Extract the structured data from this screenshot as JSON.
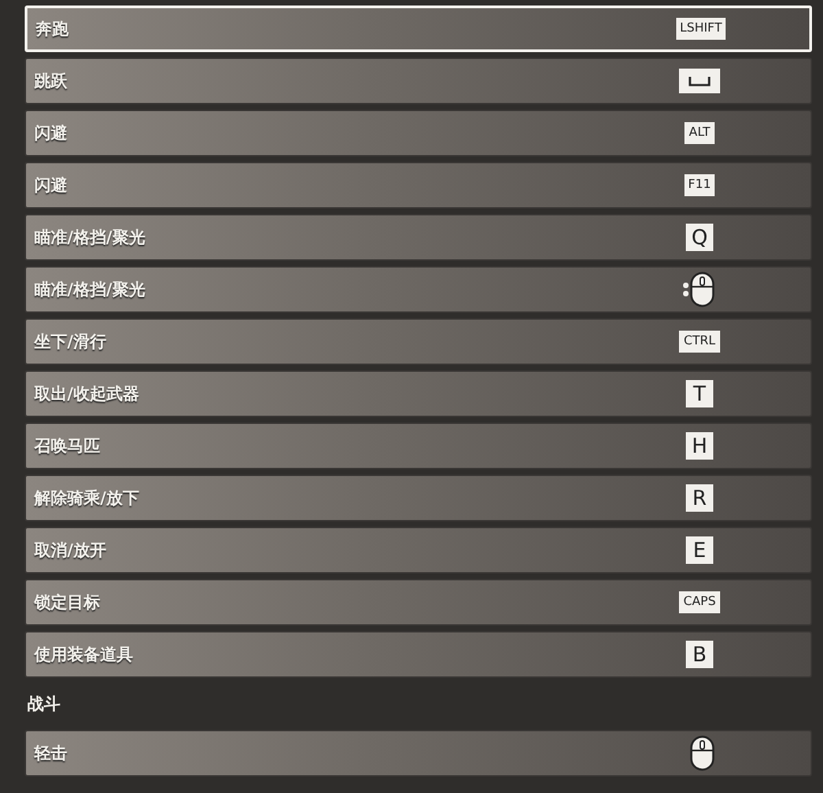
{
  "bindings": [
    {
      "action": "奔跑",
      "kind": "key",
      "key": "LSHIFT",
      "selected": true
    },
    {
      "action": "跳跃",
      "kind": "space",
      "selected": false
    },
    {
      "action": "闪避",
      "kind": "key",
      "key": "ALT",
      "selected": false
    },
    {
      "action": "闪避",
      "kind": "key",
      "key": "F11",
      "selected": false
    },
    {
      "action": "瞄准/格挡/聚光",
      "kind": "key",
      "key": "Q",
      "selected": false
    },
    {
      "action": "瞄准/格挡/聚光",
      "kind": "mouse-side",
      "selected": false
    },
    {
      "action": "坐下/滑行",
      "kind": "key",
      "key": "CTRL",
      "selected": false
    },
    {
      "action": "取出/收起武器",
      "kind": "key",
      "key": "T",
      "selected": false
    },
    {
      "action": "召唤马匹",
      "kind": "key",
      "key": "H",
      "selected": false
    },
    {
      "action": "解除骑乘/放下",
      "kind": "key",
      "key": "R",
      "selected": false
    },
    {
      "action": "取消/放开",
      "kind": "key",
      "key": "E",
      "selected": false
    },
    {
      "action": "锁定目标",
      "kind": "key",
      "key": "CAPS",
      "selected": false
    },
    {
      "action": "使用装备道具",
      "kind": "key",
      "key": "B",
      "selected": false
    }
  ],
  "section": {
    "title": "战斗",
    "bindings": [
      {
        "action": "轻击",
        "kind": "mouse-left",
        "selected": false
      }
    ]
  }
}
